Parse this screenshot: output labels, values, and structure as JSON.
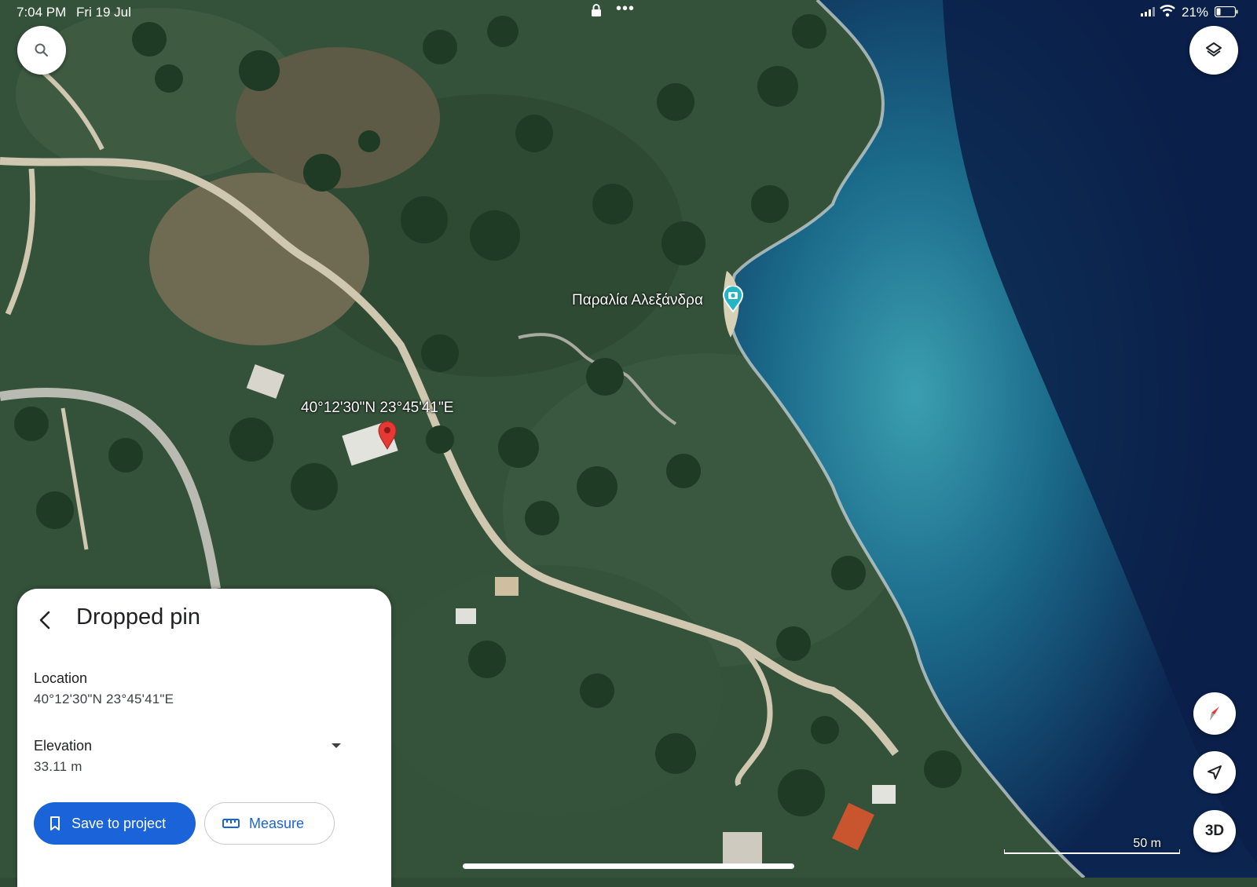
{
  "status_bar": {
    "time": "7:04 PM",
    "date": "Fri 19 Jul",
    "battery": "21%"
  },
  "map": {
    "place_label": "Παραλία Αλεξάνδρα",
    "pin_coordinates": "40°12'30\"N 23°45'41\"E",
    "scale_label": "50 m"
  },
  "controls": {
    "three_d_label": "3D"
  },
  "panel": {
    "title": "Dropped pin",
    "location_label": "Location",
    "location_value": "40°12'30\"N 23°45'41\"E",
    "elevation_label": "Elevation",
    "elevation_value": "33.11 m",
    "save_button_label": "Save to project",
    "measure_button_label": "Measure"
  },
  "colors": {
    "primary_blue": "#1a63d8",
    "pin_red": "#e53935",
    "place_pin_teal": "#22b5c4"
  },
  "icons": [
    "search-icon",
    "layers-icon",
    "compass-icon",
    "location-arrow-icon",
    "bookmark-icon",
    "ruler-icon",
    "back-arrow-icon",
    "dropdown-arrow-icon",
    "camera-pin-icon",
    "lock-icon",
    "wifi-icon",
    "signal-icon",
    "battery-icon"
  ]
}
